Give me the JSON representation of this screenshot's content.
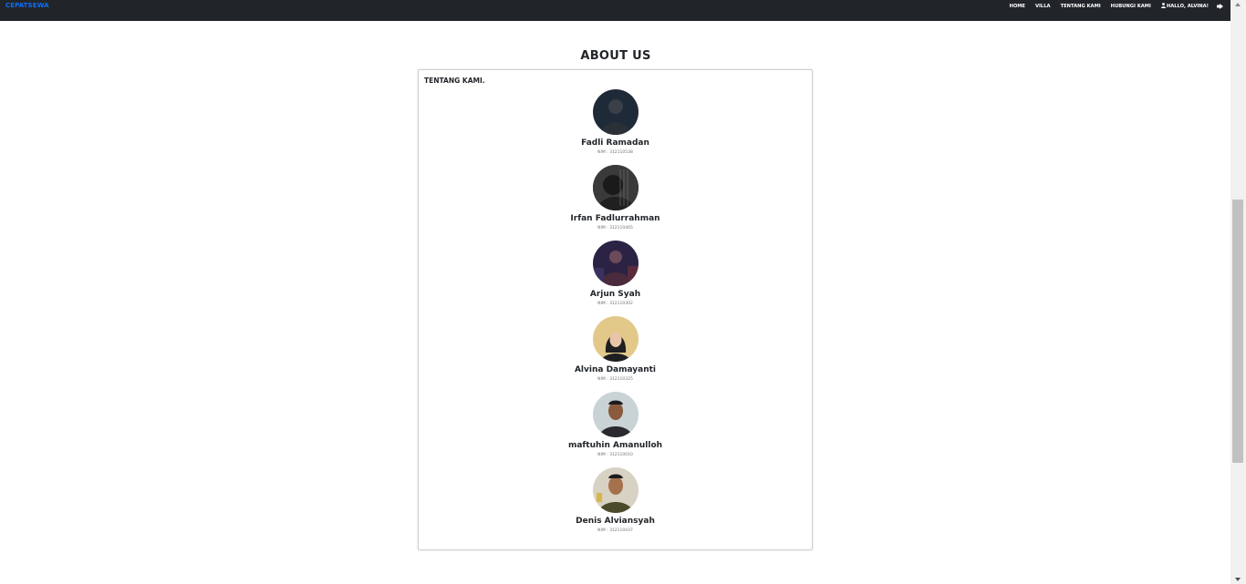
{
  "nav": {
    "brand": "CEPATSEWA",
    "links": [
      "HOME",
      "VILLA",
      "TENTANG KAMI",
      "HUBUNGI KAMI"
    ],
    "user_label": "HALLO, ALVINA!"
  },
  "main": {
    "title": "ABOUT US",
    "card_heading": "TENTANG KAMI.",
    "members": [
      {
        "name": "Fadli Ramadan",
        "nim": "NIM : 312110538"
      },
      {
        "name": "Irfan Fadlurrahman",
        "nim": "NIM : 312110465"
      },
      {
        "name": "Arjun Syah",
        "nim": "NIM : 312110302"
      },
      {
        "name": "Alvina Damayanti",
        "nim": "NIM : 312110325"
      },
      {
        "name": "maftuhin Amanulloh",
        "nim": "NIM : 312110010"
      },
      {
        "name": "Denis Alviansyah",
        "nim": "NIM : 312110437"
      }
    ]
  },
  "colors": {
    "navbar_bg": "#212529",
    "brand": "#0d6efd",
    "text": "#212529"
  },
  "icons": [
    "user-icon",
    "logout-icon"
  ]
}
